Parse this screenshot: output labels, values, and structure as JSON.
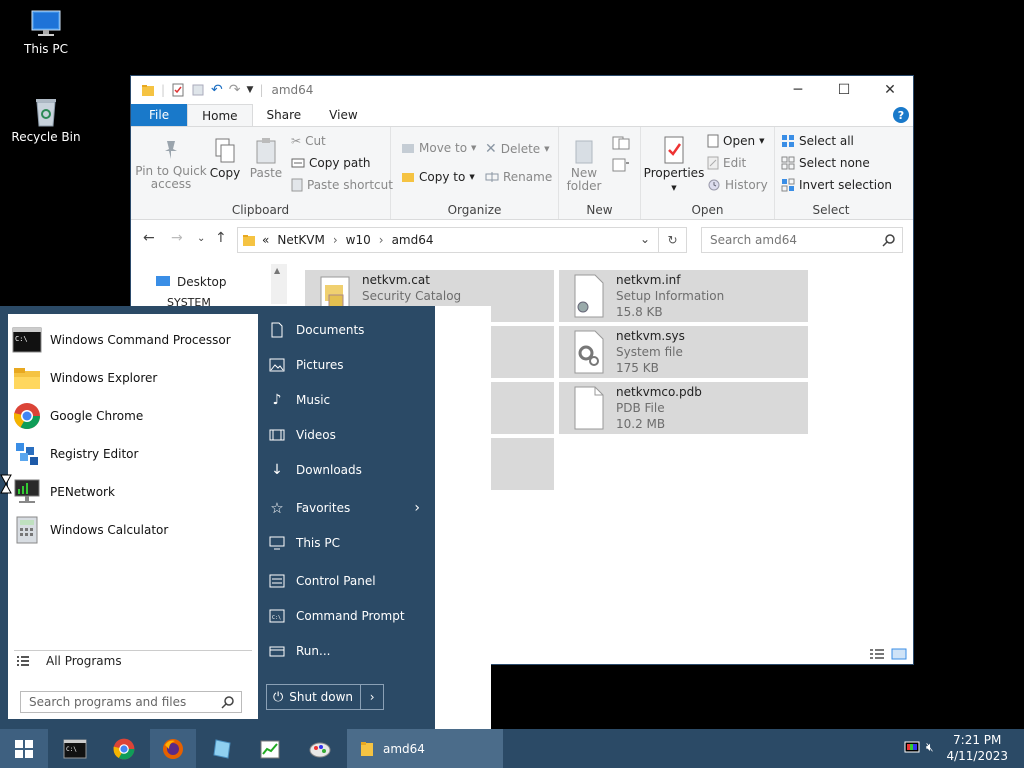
{
  "desktop": {
    "icons": [
      {
        "label": "This PC"
      },
      {
        "label": "Recycle Bin"
      }
    ]
  },
  "explorer": {
    "title": "amd64",
    "tabs": {
      "file": "File",
      "home": "Home",
      "share": "Share",
      "view": "View"
    },
    "ribbon": {
      "clipboard": {
        "label": "Clipboard",
        "pin": "Pin to Quick access",
        "copy": "Copy",
        "paste": "Paste",
        "cut": "Cut",
        "copy_path": "Copy path",
        "paste_shortcut": "Paste shortcut"
      },
      "organize": {
        "label": "Organize",
        "move_to": "Move to",
        "copy_to": "Copy to",
        "delete": "Delete",
        "rename": "Rename"
      },
      "new": {
        "label": "New",
        "new_folder": "New folder"
      },
      "open": {
        "label": "Open",
        "properties": "Properties",
        "open": "Open",
        "edit": "Edit",
        "history": "History"
      },
      "select": {
        "label": "Select",
        "select_all": "Select all",
        "select_none": "Select none",
        "invert": "Invert selection"
      }
    },
    "address": {
      "prefix": "«",
      "crumbs": [
        "NetKVM",
        "w10",
        "amd64"
      ],
      "sep": "›"
    },
    "search_placeholder": "Search amd64",
    "nav": {
      "desktop": "Desktop",
      "system": "SYSTEM"
    },
    "files": [
      {
        "name": "netkvm.cat",
        "type": "Security Catalog",
        "size": ""
      },
      {
        "name": "netkvm.inf",
        "type": "Setup Information",
        "size": "15.8 KB"
      },
      {
        "name": "netkvm.sys",
        "type": "System file",
        "size": "175 KB"
      },
      {
        "name": "netkvmco.pdb",
        "type": "PDB File",
        "size": "10.2 MB"
      }
    ]
  },
  "start_menu": {
    "programs": [
      {
        "label": "Windows Command Processor"
      },
      {
        "label": "Windows Explorer"
      },
      {
        "label": "Google Chrome"
      },
      {
        "label": "Registry Editor"
      },
      {
        "label": "PENetwork"
      },
      {
        "label": "Windows Calculator"
      }
    ],
    "all_programs": "All Programs",
    "search_placeholder": "Search programs and files",
    "right": [
      {
        "label": "Documents"
      },
      {
        "label": "Pictures"
      },
      {
        "label": "Music"
      },
      {
        "label": "Videos"
      },
      {
        "label": "Downloads"
      },
      {
        "label": "Favorites"
      },
      {
        "label": "This PC"
      },
      {
        "label": "Control Panel"
      },
      {
        "label": "Command Prompt"
      },
      {
        "label": "Run..."
      }
    ],
    "shutdown": "Shut down"
  },
  "taskbar": {
    "window_label": "amd64",
    "time": "7:21 PM",
    "date": "4/11/2023"
  }
}
